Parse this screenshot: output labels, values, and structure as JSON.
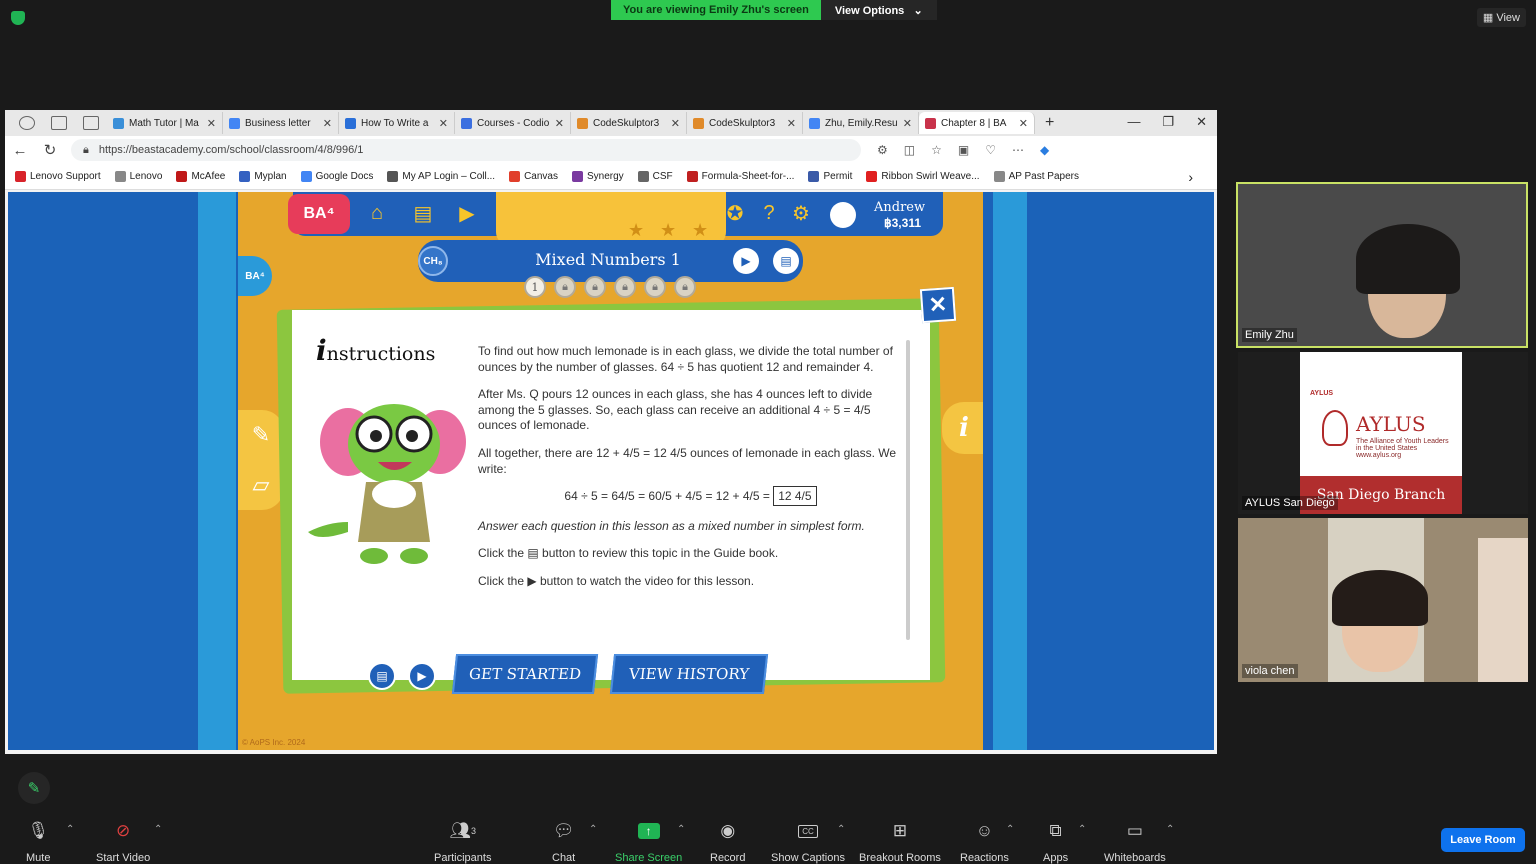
{
  "zoom": {
    "sharing_banner": "You are viewing Emily Zhu's screen",
    "view_options": "View Options",
    "view_button": "View",
    "leave_button": "Leave Room",
    "toolbar": {
      "mute": "Mute",
      "video": "Start Video",
      "participants": "Participants",
      "participants_count": "3",
      "chat": "Chat",
      "share": "Share Screen",
      "record": "Record",
      "captions": "Show Captions",
      "breakout": "Breakout Rooms",
      "reactions": "Reactions",
      "apps": "Apps",
      "whiteboards": "Whiteboards"
    },
    "participants": [
      {
        "name": "Emily Zhu"
      },
      {
        "name": "AYLUS San Diego"
      },
      {
        "name": "viola chen"
      }
    ],
    "aylus_card": {
      "logo_small": "AYLUS",
      "title": "AYLUS",
      "subtitle": "The Alliance of Youth Leaders in the United States",
      "url": "www.aylus.org",
      "branch": "San Diego Branch"
    }
  },
  "browser": {
    "tabs": [
      {
        "title": "Math Tutor | Ma",
        "color": "#3a8fd8"
      },
      {
        "title": "Business letter",
        "color": "#4285f4"
      },
      {
        "title": "How To Write a",
        "color": "#2a6fd8"
      },
      {
        "title": "Courses - Codio",
        "color": "#3b6fe0"
      },
      {
        "title": "CodeSkulptor3",
        "color": "#e08a2a"
      },
      {
        "title": "CodeSkulptor3",
        "color": "#e08a2a"
      },
      {
        "title": "Zhu, Emily.Resu",
        "color": "#4285f4"
      },
      {
        "title": "Chapter 8 | BA",
        "color": "#c8324a"
      }
    ],
    "url": "https://beastacademy.com/school/classroom/4/8/996/1",
    "bookmarks": [
      {
        "label": "Lenovo Support",
        "color": "#d8232a"
      },
      {
        "label": "Lenovo",
        "color": "#888888"
      },
      {
        "label": "McAfee",
        "color": "#c01818"
      },
      {
        "label": "Myplan",
        "color": "#3461c1"
      },
      {
        "label": "Google Docs",
        "color": "#4285f4"
      },
      {
        "label": "My AP Login – Coll...",
        "color": "#555555"
      },
      {
        "label": "Canvas",
        "color": "#e13f2b"
      },
      {
        "label": "Synergy",
        "color": "#7a3aa0"
      },
      {
        "label": "CSF",
        "color": "#666666"
      },
      {
        "label": "Formula-Sheet-for-...",
        "color": "#c02020"
      },
      {
        "label": "Permit",
        "color": "#3a5aa8"
      },
      {
        "label": "Ribbon Swirl Weave...",
        "color": "#e02020"
      },
      {
        "label": "AP Past Papers",
        "color": "#888888"
      }
    ]
  },
  "game": {
    "logo": "BA⁴",
    "user_name": "Andrew",
    "coins": "฿3,311",
    "lesson_title": "Mixed Numbers 1",
    "chapter_badge": "CH₈",
    "side_logo": "BA⁴",
    "progress_first": "1",
    "instructions_heading": "nstructions",
    "instructions_i": "i",
    "p1": "To find out how much lemonade is in each glass, we divide the total number of ounces by the number of glasses. 64 ÷ 5 has quotient 12 and remainder 4.",
    "p2": "After Ms. Q pours 12 ounces in each glass, she has 4 ounces left to divide among the 5 glasses. So, each glass can receive an additional 4 ÷ 5 = 4/5 ounces of lemonade.",
    "p3": "All together, there are 12 + 4/5 = 12 4/5 ounces of lemonade in each glass. We write:",
    "equation": "64 ÷ 5 = 64/5 = 60/5 + 4/5 = 12 + 4/5 =",
    "equation_answer": "12 4/5",
    "p4": "Answer each question in this lesson as a mixed number in simplest form.",
    "p5_pre": "Click the",
    "p5_post": "button to review this topic in the Guide book.",
    "p6_pre": "Click the",
    "p6_post": "button to watch the video for this lesson.",
    "get_started": "GET STARTED",
    "view_history": "VIEW HISTORY",
    "copyright": "© AoPS Inc. 2024"
  }
}
